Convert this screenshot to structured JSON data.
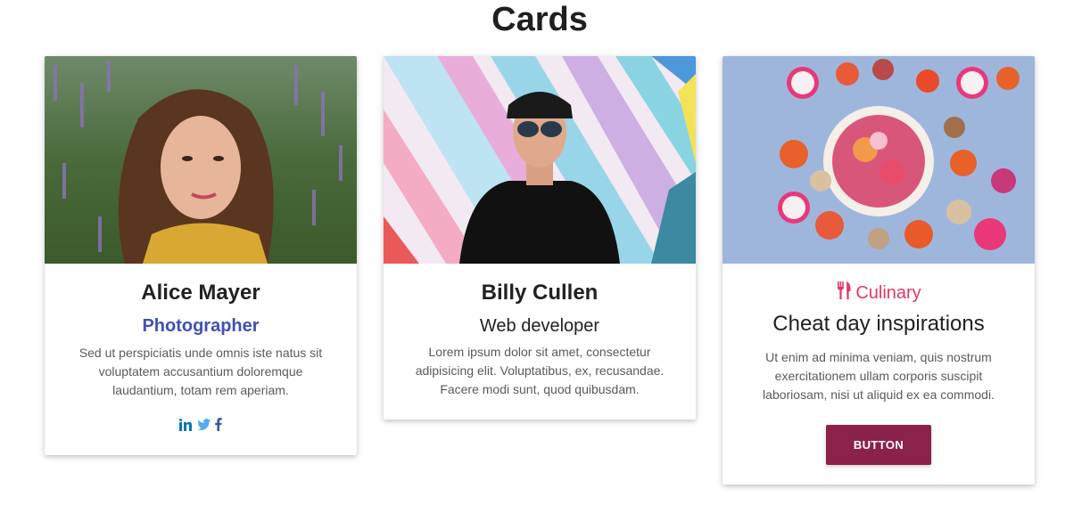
{
  "page": {
    "title": "Cards"
  },
  "cards": [
    {
      "name": "Alice Mayer",
      "role": "Photographer",
      "description": "Sed ut perspiciatis unde omnis iste natus sit voluptatem accusantium doloremque laudantium, totam rem aperiam.",
      "social_icons": [
        "linkedin-icon",
        "twitter-icon",
        "facebook-icon"
      ],
      "accent_color": "#3f51b5"
    },
    {
      "name": "Billy Cullen",
      "role": "Web developer",
      "description": "Lorem ipsum dolor sit amet, consectetur adipisicing elit. Voluptatibus, ex, recusandae. Facere modi sunt, quod quibusdam."
    },
    {
      "category": "Culinary",
      "category_icon": "cutlery-icon",
      "category_color": "#e33866",
      "headline": "Cheat day inspirations",
      "description": "Ut enim ad minima veniam, quis nostrum exercitationem ullam corporis suscipit laboriosam, nisi ut aliquid ex ea commodi.",
      "button_label": "BUTTON",
      "button_color": "#8a224b"
    }
  ]
}
